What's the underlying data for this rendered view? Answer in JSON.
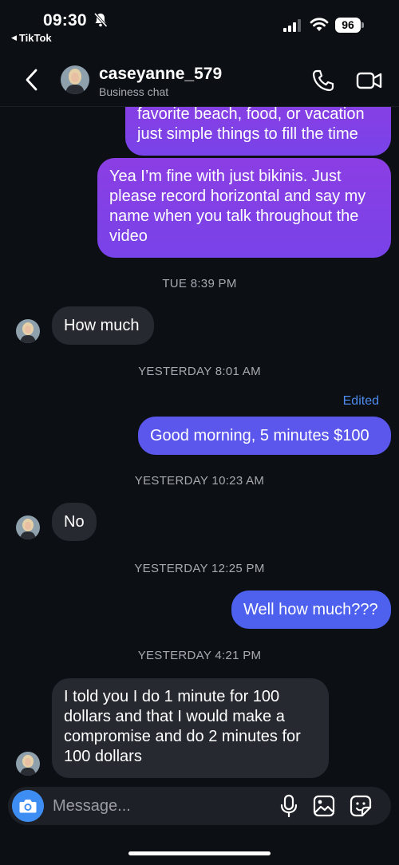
{
  "status": {
    "time": "09:30",
    "back_app": "TikTok",
    "battery": "96"
  },
  "header": {
    "name": "caseyanne_579",
    "subtitle": "Business chat"
  },
  "messages": [
    {
      "kind": "out",
      "text": "favorite beach, food, or vacation just simple things to fill the time"
    },
    {
      "kind": "out",
      "text": "Yea I’m fine with just bikinis. Just please record horizontal and say my name when you talk throughout the video"
    },
    {
      "kind": "stamp",
      "text": "TUE 8:39 PM"
    },
    {
      "kind": "in",
      "text": "How much"
    },
    {
      "kind": "stamp",
      "text": "YESTERDAY 8:01 AM"
    },
    {
      "kind": "edited",
      "text": "Edited"
    },
    {
      "kind": "out",
      "text": "Good morning, 5 minutes $100"
    },
    {
      "kind": "stamp",
      "text": "YESTERDAY 10:23 AM"
    },
    {
      "kind": "in",
      "text": "No"
    },
    {
      "kind": "stamp",
      "text": "YESTERDAY 12:25 PM"
    },
    {
      "kind": "out",
      "text": "Well how much???"
    },
    {
      "kind": "stamp",
      "text": "YESTERDAY 4:21 PM"
    },
    {
      "kind": "in",
      "text": "I told you I do 1 minute for 100 dollars and that I would make a compromise and do 2 minutes for 100 dollars"
    }
  ],
  "composer": {
    "placeholder": "Message..."
  },
  "colors": {
    "background": "#0c0f14",
    "outgoing_purple": "#8b3ee3",
    "outgoing_blue": "#4d61ee",
    "incoming": "#262930",
    "accent_blue": "#3e8df2"
  },
  "icons": [
    "bell-slash-icon",
    "signal-icon",
    "wifi-icon",
    "chevron-left-icon",
    "phone-icon",
    "video-camera-icon",
    "camera-icon",
    "microphone-icon",
    "gallery-icon",
    "sticker-icon"
  ]
}
